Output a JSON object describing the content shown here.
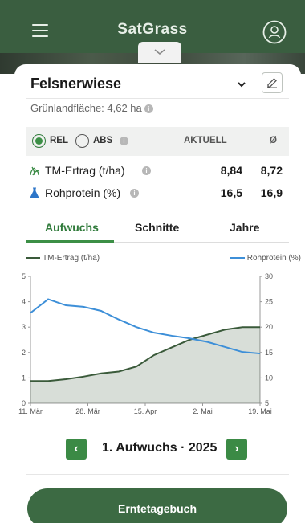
{
  "app": {
    "title": "SatGrass"
  },
  "field": {
    "name": "Felsnerwiese",
    "area_label": "Grünlandfläche: 4,62 ha"
  },
  "table": {
    "rel_label": "REL",
    "abs_label": "ABS",
    "mode_selected": "REL",
    "col_current": "AKTUELL",
    "col_avg": "Ø",
    "rows": [
      {
        "label": "TM-Ertrag (t/ha)",
        "current": "8,84",
        "avg": "8,72",
        "icon": "grass-icon"
      },
      {
        "label": "Rohprotein (%)",
        "current": "16,5",
        "avg": "16,9",
        "icon": "flask-icon"
      }
    ]
  },
  "tabs": [
    {
      "label": "Aufwuchs",
      "active": true
    },
    {
      "label": "Schnitte",
      "active": false
    },
    {
      "label": "Jahre",
      "active": false
    }
  ],
  "colors": {
    "primary": "#3c6a43",
    "accent": "#3c8f46",
    "protein": "#3d8fd8",
    "yield": "#3a5a3a"
  },
  "chart_data": {
    "type": "line",
    "x": [
      "11. Mär",
      "18. Mär",
      "25. Mär",
      "01. Apr",
      "08. Apr",
      "15. Apr",
      "22. Apr",
      "29. Apr",
      "02. Mai",
      "06. Mai",
      "10. Mai",
      "13. Mai",
      "16. Mai",
      "19. Mai"
    ],
    "x_ticks": [
      "11. Mär",
      "28. Mär",
      "15. Apr",
      "2. Mai",
      "19. Mai"
    ],
    "series": [
      {
        "name": "TM-Ertrag (t/ha)",
        "axis": "left",
        "values": [
          0.88,
          0.88,
          0.95,
          1.05,
          1.18,
          1.25,
          1.45,
          1.9,
          2.2,
          2.5,
          2.7,
          2.9,
          3.0,
          3.0
        ]
      },
      {
        "name": "Rohprotein (%)",
        "axis": "right",
        "values": [
          22.8,
          25.5,
          24.3,
          24.0,
          23.2,
          21.5,
          20.0,
          18.9,
          18.3,
          17.8,
          17.1,
          16.1,
          15.1,
          14.8
        ]
      }
    ],
    "y_left": {
      "ticks": [
        "0",
        "1",
        "2",
        "3",
        "4",
        "5"
      ],
      "range": [
        0,
        5
      ]
    },
    "y_right": {
      "ticks": [
        "5",
        "10",
        "15",
        "20",
        "25",
        "30"
      ],
      "range": [
        5,
        30
      ]
    },
    "grid": false
  },
  "pager": {
    "label": "1. Aufwuchs · 2025",
    "prev": "‹",
    "next": "›"
  },
  "actions": {
    "diary_label": "Erntetagebuch"
  }
}
